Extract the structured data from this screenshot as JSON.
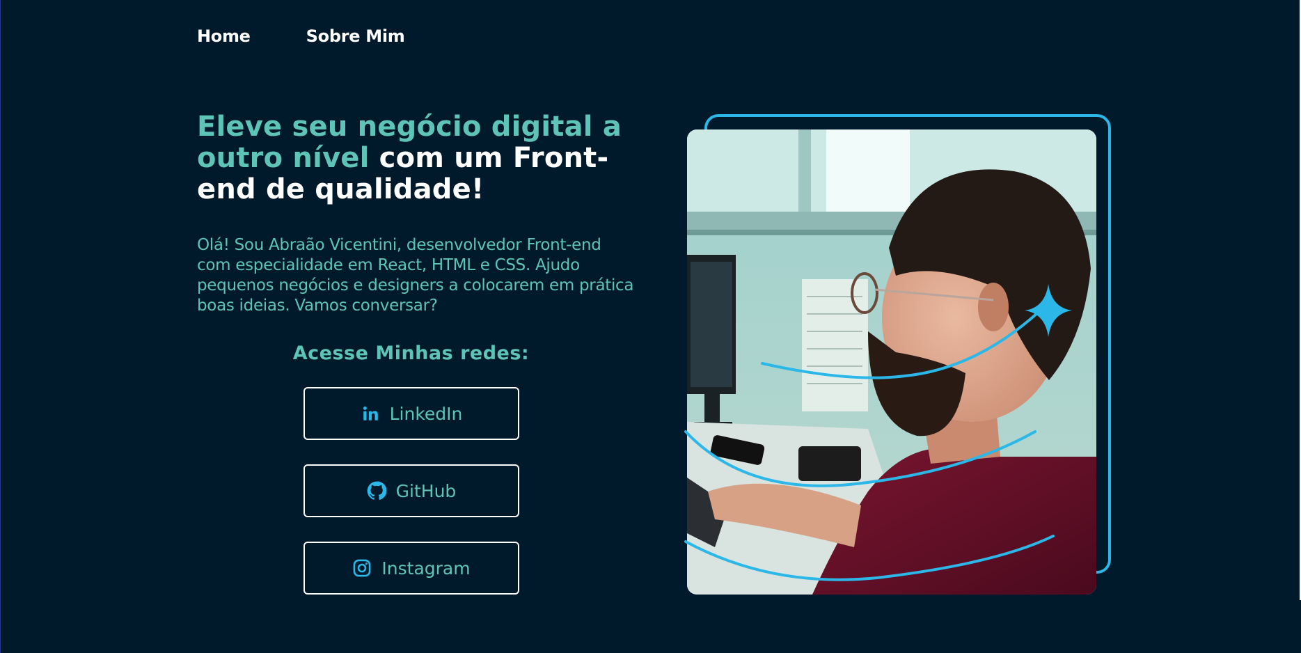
{
  "nav": {
    "home": "Home",
    "about": "Sobre Mim"
  },
  "hero": {
    "title_accent": "Eleve seu negócio digital a outro nível",
    "title_rest": "com um Front-end de qualidade!",
    "intro": "Olá! Sou Abraão Vicentini, desenvolvedor Front-end com especialidade em React, HTML e CSS. Ajudo pequenos negócios e designers a colocarem em prática boas ideias. Vamos conversar?"
  },
  "socials": {
    "title": "Acesse Minhas redes:",
    "linkedin": "LinkedIn",
    "github": "GitHub",
    "instagram": "Instagram"
  },
  "icons": {
    "linkedin": "linkedin-icon",
    "github": "github-icon",
    "instagram": "instagram-icon",
    "sparkle": "sparkle-icon"
  },
  "colors": {
    "background": "#001a2c",
    "accent": "#5fc4b8",
    "frame": "#2bb8e8",
    "text": "#ffffff"
  }
}
